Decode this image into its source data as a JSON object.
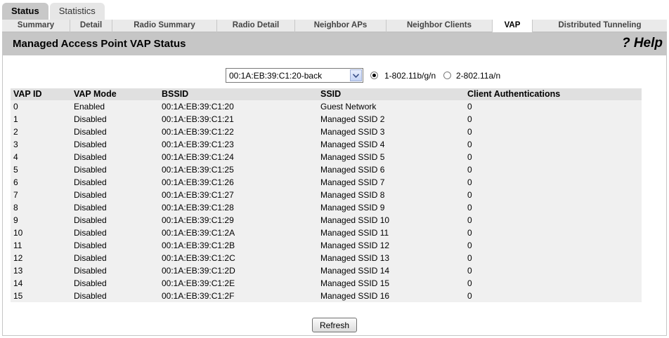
{
  "top_tabs": [
    {
      "label": "Status",
      "active": true
    },
    {
      "label": "Statistics",
      "active": false
    }
  ],
  "sub_tabs": [
    {
      "label": "Summary",
      "active": false
    },
    {
      "label": "Detail",
      "active": false
    },
    {
      "label": "Radio Summary",
      "active": false
    },
    {
      "label": "Radio Detail",
      "active": false
    },
    {
      "label": "Neighbor APs",
      "active": false
    },
    {
      "label": "Neighbor Clients",
      "active": false
    },
    {
      "label": "VAP",
      "active": true
    },
    {
      "label": "Distributed Tunneling",
      "active": false
    }
  ],
  "page": {
    "title": "Managed Access Point VAP Status",
    "help": "? Help"
  },
  "ap_select": {
    "selected": "00:1A:EB:39:C1:20-back"
  },
  "radios": [
    {
      "label": "1-802.11b/g/n",
      "checked": true
    },
    {
      "label": "2-802.11a/n",
      "checked": false
    }
  ],
  "table": {
    "headers": [
      "VAP ID",
      "VAP Mode",
      "BSSID",
      "SSID",
      "Client Authentications"
    ],
    "rows": [
      [
        "0",
        "Enabled",
        "00:1A:EB:39:C1:20",
        "Guest Network",
        "0"
      ],
      [
        "1",
        "Disabled",
        "00:1A:EB:39:C1:21",
        "Managed SSID 2",
        "0"
      ],
      [
        "2",
        "Disabled",
        "00:1A:EB:39:C1:22",
        "Managed SSID 3",
        "0"
      ],
      [
        "3",
        "Disabled",
        "00:1A:EB:39:C1:23",
        "Managed SSID 4",
        "0"
      ],
      [
        "4",
        "Disabled",
        "00:1A:EB:39:C1:24",
        "Managed SSID 5",
        "0"
      ],
      [
        "5",
        "Disabled",
        "00:1A:EB:39:C1:25",
        "Managed SSID 6",
        "0"
      ],
      [
        "6",
        "Disabled",
        "00:1A:EB:39:C1:26",
        "Managed SSID 7",
        "0"
      ],
      [
        "7",
        "Disabled",
        "00:1A:EB:39:C1:27",
        "Managed SSID 8",
        "0"
      ],
      [
        "8",
        "Disabled",
        "00:1A:EB:39:C1:28",
        "Managed SSID 9",
        "0"
      ],
      [
        "9",
        "Disabled",
        "00:1A:EB:39:C1:29",
        "Managed SSID 10",
        "0"
      ],
      [
        "10",
        "Disabled",
        "00:1A:EB:39:C1:2A",
        "Managed SSID 11",
        "0"
      ],
      [
        "11",
        "Disabled",
        "00:1A:EB:39:C1:2B",
        "Managed SSID 12",
        "0"
      ],
      [
        "12",
        "Disabled",
        "00:1A:EB:39:C1:2C",
        "Managed SSID 13",
        "0"
      ],
      [
        "13",
        "Disabled",
        "00:1A:EB:39:C1:2D",
        "Managed SSID 14",
        "0"
      ],
      [
        "14",
        "Disabled",
        "00:1A:EB:39:C1:2E",
        "Managed SSID 15",
        "0"
      ],
      [
        "15",
        "Disabled",
        "00:1A:EB:39:C1:2F",
        "Managed SSID 16",
        "0"
      ]
    ]
  },
  "refresh_label": "Refresh",
  "icons": {
    "dropdown": "chevron-down-icon"
  }
}
